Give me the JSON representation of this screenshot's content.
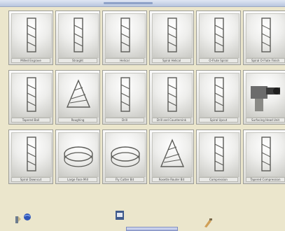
{
  "window": {
    "title": ""
  },
  "tools": [
    {
      "label": "Milled Engrave",
      "icon": "milling-tool-icon"
    },
    {
      "label": "Straight",
      "icon": "straight-end-mill-icon"
    },
    {
      "label": "Helical",
      "icon": "helical-end-mill-icon"
    },
    {
      "label": "Spiral Helical",
      "icon": "spiral-end-mill-icon"
    },
    {
      "label": "O-Flute Spiral",
      "icon": "o-flute-bit-icon"
    },
    {
      "label": "Spiral O-Flute Finish",
      "icon": "finishing-bit-icon"
    },
    {
      "label": "Tapered Ball",
      "icon": "tapered-ball-bit-icon"
    },
    {
      "label": "Roughing",
      "icon": "roughing-cutter-icon"
    },
    {
      "label": "Drill",
      "icon": "drill-bit-icon"
    },
    {
      "label": "Drill and Countersink",
      "icon": "countersink-drill-icon"
    },
    {
      "label": "Spiral Upcut",
      "icon": "upcut-spiral-icon"
    },
    {
      "label": "Surfacing Head Unit",
      "icon": "spindle-head-icon"
    },
    {
      "label": "Spiral Downcut",
      "icon": "downcut-spiral-icon"
    },
    {
      "label": "Large Face Mill",
      "icon": "face-mill-icon"
    },
    {
      "label": "Fly Cutter Bit",
      "icon": "fly-cutter-icon"
    },
    {
      "label": "Rosette Router Bit",
      "icon": "rosette-bit-icon"
    },
    {
      "label": "Compression",
      "icon": "compression-bit-icon"
    },
    {
      "label": "Tapered Compression",
      "icon": "tapered-compression-icon"
    }
  ],
  "taskbar": {
    "items": [
      {
        "icon": "cutter-app-icon"
      },
      {
        "icon": "globe-app-icon"
      },
      {
        "icon": "program-window-icon"
      },
      {
        "icon": "tool-app-icon"
      }
    ]
  }
}
